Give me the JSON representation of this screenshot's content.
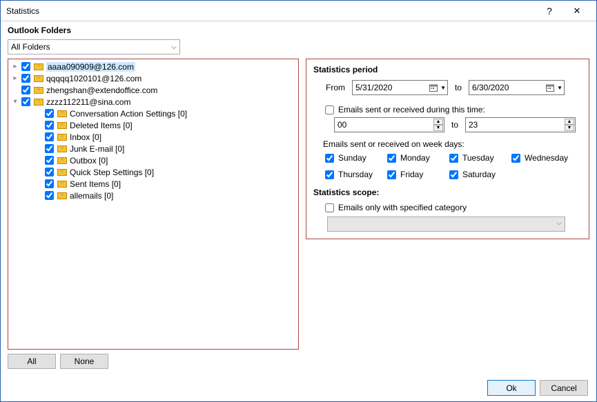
{
  "window": {
    "title": "Statistics",
    "help": "?",
    "close": "✕"
  },
  "outlook_folders": {
    "header": "Outlook Folders",
    "dropdown": "All Folders",
    "all_button": "All",
    "none_button": "None"
  },
  "tree": {
    "accounts": [
      {
        "label": "aaaa090909@126.com",
        "expander": "exp",
        "checked": true,
        "selected": true,
        "indent": 0
      },
      {
        "label": "qqqqq1020101@126.com",
        "expander": "exp",
        "checked": true,
        "selected": false,
        "indent": 0
      },
      {
        "label": "zhengshan@extendoffice.com",
        "expander": "none",
        "checked": true,
        "selected": false,
        "indent": 0
      },
      {
        "label": "zzzz112211@sina.com",
        "expander": "col",
        "checked": true,
        "selected": false,
        "indent": 0
      },
      {
        "label": "Conversation Action Settings [0]",
        "expander": "none",
        "checked": true,
        "selected": false,
        "indent": 1
      },
      {
        "label": "Deleted Items [0]",
        "expander": "none",
        "checked": true,
        "selected": false,
        "indent": 1
      },
      {
        "label": "Inbox [0]",
        "expander": "none",
        "checked": true,
        "selected": false,
        "indent": 1
      },
      {
        "label": "Junk E-mail [0]",
        "expander": "none",
        "checked": true,
        "selected": false,
        "indent": 1
      },
      {
        "label": "Outbox [0]",
        "expander": "none",
        "checked": true,
        "selected": false,
        "indent": 1
      },
      {
        "label": "Quick Step Settings [0]",
        "expander": "none",
        "checked": true,
        "selected": false,
        "indent": 1
      },
      {
        "label": "Sent Items [0]",
        "expander": "none",
        "checked": true,
        "selected": false,
        "indent": 1
      },
      {
        "label": "allemails [0]",
        "expander": "none",
        "checked": true,
        "selected": false,
        "indent": 1
      }
    ]
  },
  "period": {
    "title": "Statistics period",
    "from_label": "From",
    "to_label": "to",
    "from_date": "5/31/2020",
    "to_date": "6/30/2020",
    "time_filter_label": "Emails sent or received during this time:",
    "time_from": "00",
    "time_to": "23",
    "weekdays_label": "Emails sent or received on week days:",
    "days": [
      {
        "label": "Sunday",
        "checked": true
      },
      {
        "label": "Monday",
        "checked": true
      },
      {
        "label": "Tuesday",
        "checked": true
      },
      {
        "label": "Wednesday",
        "checked": true
      },
      {
        "label": "Thursday",
        "checked": true
      },
      {
        "label": "Friday",
        "checked": true
      },
      {
        "label": "Saturday",
        "checked": true
      }
    ]
  },
  "scope": {
    "title": "Statistics scope:",
    "category_label": "Emails only with specified category"
  },
  "footer": {
    "ok": "Ok",
    "cancel": "Cancel"
  }
}
